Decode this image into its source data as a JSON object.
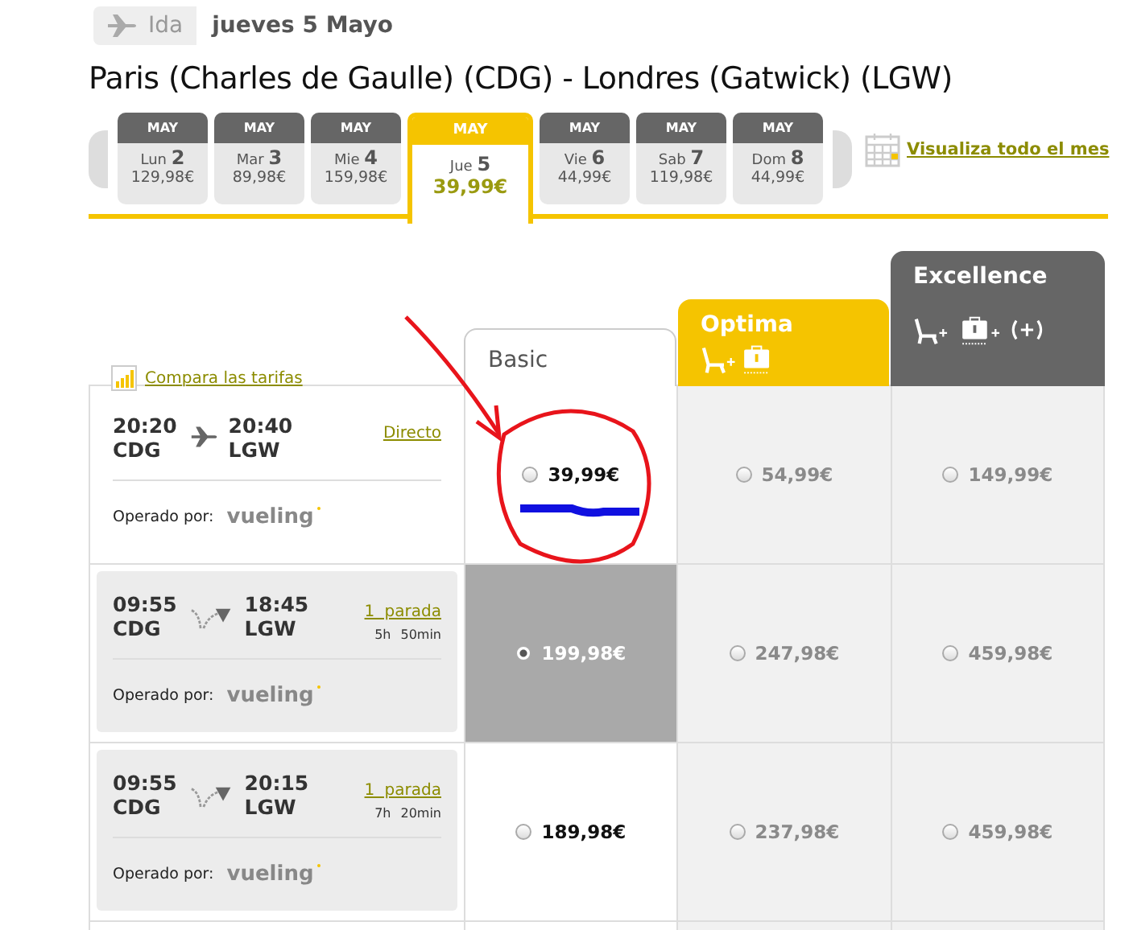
{
  "trip": {
    "direction": "Ida",
    "date": "jueves 5 Mayo"
  },
  "route": "Paris (Charles de Gaulle) (CDG) - Londres (Gatwick) (LGW)",
  "days": [
    {
      "month": "MAY",
      "weekday": "Lun",
      "day": "2",
      "price": "129,98€",
      "selected": false
    },
    {
      "month": "MAY",
      "weekday": "Mar",
      "day": "3",
      "price": "89,98€",
      "selected": false
    },
    {
      "month": "MAY",
      "weekday": "Mie",
      "day": "4",
      "price": "159,98€",
      "selected": false
    },
    {
      "month": "MAY",
      "weekday": "Jue",
      "day": "5",
      "price": "39,99€",
      "selected": true
    },
    {
      "month": "MAY",
      "weekday": "Vie",
      "day": "6",
      "price": "44,99€",
      "selected": false
    },
    {
      "month": "MAY",
      "weekday": "Sab",
      "day": "7",
      "price": "119,98€",
      "selected": false
    },
    {
      "month": "MAY",
      "weekday": "Dom",
      "day": "8",
      "price": "44,99€",
      "selected": false
    }
  ],
  "calendar_link": "Visualiza todo el mes",
  "compare_link": "Compara las tarifas",
  "fares": [
    {
      "name": "Basic",
      "kind": "basic"
    },
    {
      "name": "Optima",
      "kind": "optima"
    },
    {
      "name": "Excellence",
      "kind": "excellence"
    }
  ],
  "flights": [
    {
      "kind": "direct",
      "shaded": false,
      "depart_time": "20:20",
      "depart_airport": "CDG",
      "arrive_time": "20:40",
      "arrive_airport": "LGW",
      "stops": "Directo",
      "operator_label": "Operado por:",
      "airline": "vueling",
      "prices": [
        {
          "price": "39,99€",
          "selected": false,
          "disabled": false
        },
        {
          "price": "54,99€",
          "selected": false,
          "disabled": true
        },
        {
          "price": "149,99€",
          "selected": false,
          "disabled": true
        }
      ]
    },
    {
      "kind": "connection",
      "shaded": true,
      "depart_time": "09:55",
      "depart_airport": "CDG",
      "arrive_time": "18:45",
      "arrive_airport": "LGW",
      "stops": "1 parada",
      "duration_hours": "5h",
      "duration_minutes": "50min",
      "operator_label": "Operado por:",
      "airline": "vueling",
      "prices": [
        {
          "price": "199,98€",
          "selected": true,
          "disabled": false
        },
        {
          "price": "247,98€",
          "selected": false,
          "disabled": true
        },
        {
          "price": "459,98€",
          "selected": false,
          "disabled": true
        }
      ]
    },
    {
      "kind": "connection",
      "shaded": true,
      "depart_time": "09:55",
      "depart_airport": "CDG",
      "arrive_time": "20:15",
      "arrive_airport": "LGW",
      "stops": "1 parada",
      "duration_hours": "7h",
      "duration_minutes": "20min",
      "operator_label": "Operado por:",
      "airline": "vueling",
      "prices": [
        {
          "price": "189,98€",
          "selected": false,
          "disabled": false
        },
        {
          "price": "237,98€",
          "selected": false,
          "disabled": true
        },
        {
          "price": "459,98€",
          "selected": false,
          "disabled": true
        }
      ]
    }
  ]
}
